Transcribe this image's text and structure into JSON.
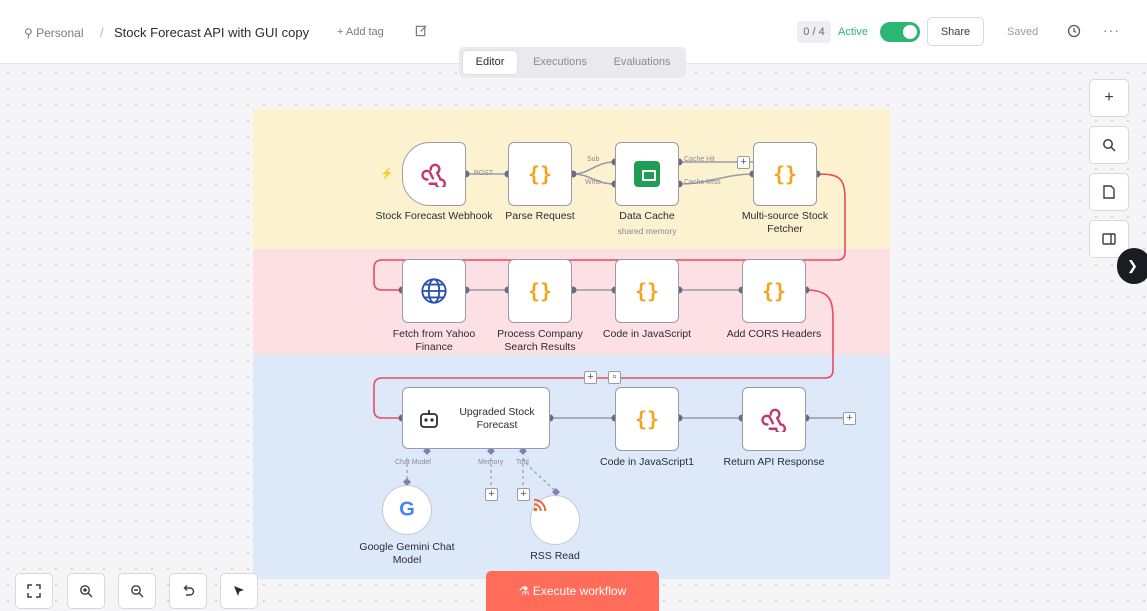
{
  "header": {
    "breadcrumb_personal": "Personal",
    "separator": "/",
    "workflow_title": "Stock Forecast API with GUI copy",
    "add_tag": "+ Add tag",
    "counter": "0 / 4",
    "active_label": "Active",
    "active": true,
    "share_label": "Share",
    "saved_label": "Saved",
    "more": "···"
  },
  "tabs": [
    {
      "label": "Editor",
      "active": true
    },
    {
      "label": "Executions",
      "active": false
    },
    {
      "label": "Evaluations",
      "active": false
    }
  ],
  "nodes": {
    "webhook": {
      "label": "Stock Forecast Webhook",
      "port_out": "POST"
    },
    "parse_request": {
      "label": "Parse Request"
    },
    "data_cache": {
      "label": "Data Cache",
      "sub": "shared memory",
      "port_in_1": "Sub",
      "port_in_2": "Write",
      "port_out_1": "Cache Hit",
      "port_out_2": "Cache Miss"
    },
    "multi_source": {
      "label": "Multi-source Stock Fetcher"
    },
    "yahoo": {
      "label": "Fetch from Yahoo Finance"
    },
    "process_company": {
      "label": "Process Company Search Results"
    },
    "code_js": {
      "label": "Code in JavaScript"
    },
    "cors": {
      "label": "Add CORS Headers"
    },
    "forecast": {
      "label": "Upgraded Stock Forecast",
      "port_model": "Chat Model",
      "port_memory": "Memory",
      "port_tool": "Tool"
    },
    "code_js1": {
      "label": "Code in JavaScript1"
    },
    "return_api": {
      "label": "Return API Response"
    },
    "gemini": {
      "label": "Google Gemini Chat Model",
      "letter": "G"
    },
    "rss": {
      "label": "RSS Read"
    }
  },
  "toolbar": {
    "zoom_in": "+",
    "plus": "+",
    "execute_label": "Execute workflow"
  },
  "icons": {
    "accent": "#ff6d5a",
    "active_green": "#2bb673",
    "code_orange": "#f2a41b"
  }
}
